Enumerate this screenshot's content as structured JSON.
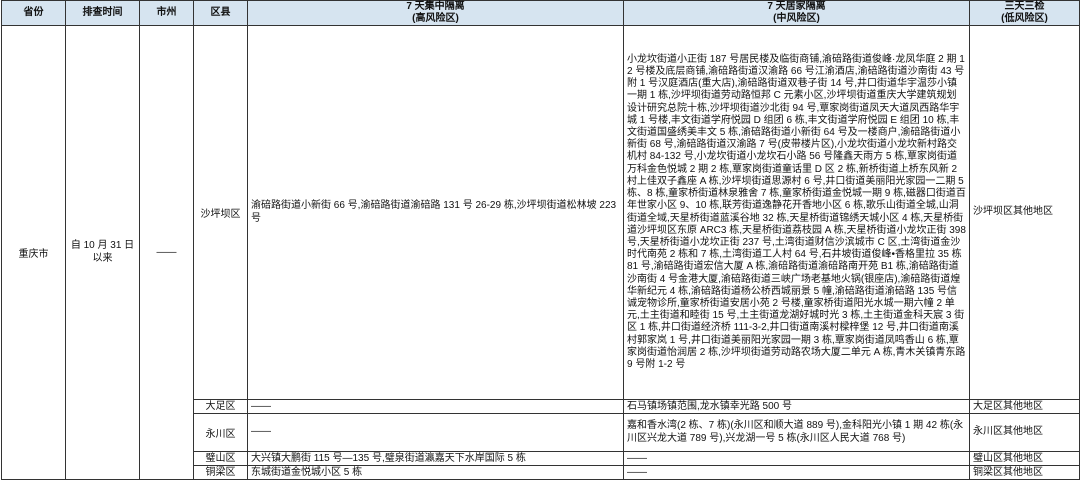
{
  "header": {
    "province": "省份",
    "time": "排查时间",
    "city": "市州",
    "district": "区县",
    "high_risk": {
      "line1": "7 天集中隔离",
      "line2": "(高风险区)"
    },
    "mid_risk": {
      "line1": "7 天居家隔离",
      "line2": "(中风险区)"
    },
    "low_risk": {
      "line1": "三天三检",
      "line2": "(低风险区)"
    }
  },
  "province": "重庆市",
  "time": "自 10 月 31 日以来",
  "city": "——",
  "rows": [
    {
      "district": "沙坪坝区",
      "high": "渝碚路街道小新街 66 号,渝碚路街道渝碚路 131 号 26-29 栋,沙坪坝街道松林坡 223 号",
      "mid": "小龙坎街道小正街 187 号居民楼及临街商铺,渝碚路街道俊峰·龙凤华庭 2 期 12 号楼及底层商铺,渝碚路街道汉渝路 66 号江渝酒店,渝碚路街道沙南街 43 号附 1 号汉庭酒店(重大店),渝碚路街道双巷子街 14 号,井口街道华宇温莎小镇一期 1 栋,沙坪坝街道劳动路恒邦 C 元素小区,沙坪坝街道重庆大学建筑规划设计研究总院十栋,沙坪坝街道沙北街 94 号,覃家岗街道凤天大道凤西路华宇城 1 号楼,丰文街道学府悦园 D 组团 6 栋,丰文街道学府悦园 E 组团 10 栋,丰文街道国盛绣美丰文 5 栋,渝碚路街道小新街 64 号及一楼商户,渝碚路街道小新街 68 号,渝碚路街道汉渝路 7 号(皮带楼片区),小龙坎街道小龙坎新村路交机村 84-132 号,小龙坎街道小龙坎石小路 56 号隆鑫天雨方 5 栋,覃家岗街道万科金色悦城 2 期 2 栋,覃家岗街道童话里 D 区 2 栋,新桥街道上桥东风新 2 村上佳双子鑫座 A 栋,沙坪坝街道思源村 6 号,井口街道美丽阳光家园一二期 5 栋、8 栋,童家桥街道林泉雅舍 7 栋,童家桥街道金悦城一期 9 栋,磁器口街道百年世家小区 9、10 栋,联芳街道逸静花开香地小区 6 栋,歌乐山街道全城,山洞街道全域,天星桥街道蓝溪谷地 32 栋,天星桥街道锦绣天城小区 4 栋,天星桥街道沙坪坝区东原 ARC3 栋,天星桥街道荔枝园 A 栋,天星桥街道小龙坎正街 398 号,天星桥街道小龙坎正街 237 号,土湾街道财信沙滨城市 C 区,土湾街道金沙时代南苑 2 栋和 7 栋,土湾街道工人村 64 号,石井坡街道俊峰•香格里拉 35 栋 81 号,渝碚路街道宏信大厦 A 栋,渝碚路街道渝碚路南开苑 B1 栋,渝碚路街道沙南街 4 号金港大厦,渝碚路街道三峡广场老基地火锅(银座店),渝碚路街道煌华新纪元 4 栋,渝碚路街道杨公桥西城丽景 5 幢,渝碚路街道渝碚路 135 号信诚宠物诊所,童家桥街道安居小苑 2 号楼,童家桥街道阳光水城一期六幢 2 单元,土主街道和睦街 15 号,土主街道龙湖好城时光 3 栋,土主街道金科天宸 3 街区 1 栋,井口街道经济桥 111-3-2,井口街道南溪村樑梓堡 12 号,井口街道南溪村郭家岚 1 号,井口街道美丽阳光家园一期 3 栋,覃家岗街道凤鸣香山 6 栋,覃家岗街道怡润居 2 栋,沙坪坝街道劳动路农场大厦二单元 A 栋,青木关镇青东路 9 号附 1-2 号",
      "low": "沙坪坝区其他地区"
    },
    {
      "district": "大足区",
      "high": "——",
      "mid": "石马镇场镇范围,龙水镇幸光路 500 号",
      "low": "大足区其他地区"
    },
    {
      "district": "永川区",
      "high": "——",
      "mid": "嘉和香水湾(2 栋、7 栋)(永川区和顺大道 889 号),金科阳光小镇 1 期 42 栋(永川区兴龙大道 789 号),兴龙湖一号 5 栋(永川区人民大道 768 号)",
      "low": "永川区其他地区"
    },
    {
      "district": "璧山区",
      "high": "大兴镇大鹏街 115 号—135 号,璧泉街道瀛嘉天下水岸国际 5 栋",
      "mid": "——",
      "low": "璧山区其他地区"
    },
    {
      "district": "铜梁区",
      "high": "东城街道金悦城小区 5 栋",
      "mid": "——",
      "low": "铜梁区其他地区"
    }
  ]
}
